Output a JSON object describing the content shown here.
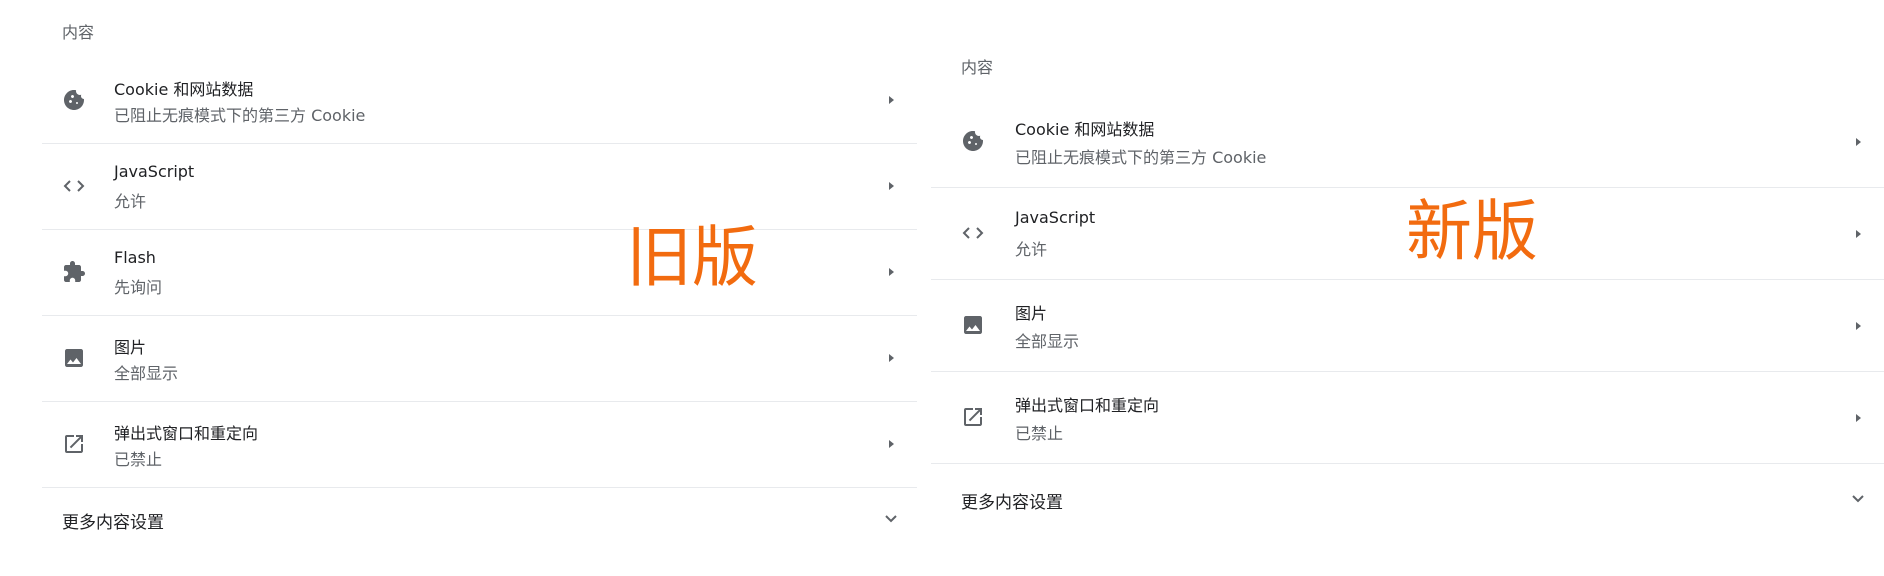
{
  "colors": {
    "accent_orange": "#f26b0f",
    "icon_gray": "#5f6368",
    "divider": "#e8eaed"
  },
  "old_panel": {
    "version_label": "旧版",
    "section_title": "内容",
    "rows": [
      {
        "icon": "cookie-icon",
        "primary": "Cookie 和网站数据",
        "secondary": "已阻止无痕模式下的第三方 Cookie"
      },
      {
        "icon": "code-icon",
        "primary": "JavaScript",
        "secondary": "允许"
      },
      {
        "icon": "puzzle-extension-icon",
        "primary": "Flash",
        "secondary": "先询问"
      },
      {
        "icon": "image-icon",
        "primary": "图片",
        "secondary": "全部显示"
      },
      {
        "icon": "open-in-new-icon",
        "primary": "弹出式窗口和重定向",
        "secondary": "已禁止"
      }
    ],
    "more_label": "更多内容设置"
  },
  "new_panel": {
    "version_label": "新版",
    "section_title": "内容",
    "rows": [
      {
        "icon": "cookie-icon",
        "primary": "Cookie 和网站数据",
        "secondary": "已阻止无痕模式下的第三方 Cookie"
      },
      {
        "icon": "code-icon",
        "primary": "JavaScript",
        "secondary": "允许"
      },
      {
        "icon": "image-icon",
        "primary": "图片",
        "secondary": "全部显示"
      },
      {
        "icon": "open-in-new-icon",
        "primary": "弹出式窗口和重定向",
        "secondary": "已禁止"
      }
    ],
    "more_label": "更多内容设置"
  }
}
